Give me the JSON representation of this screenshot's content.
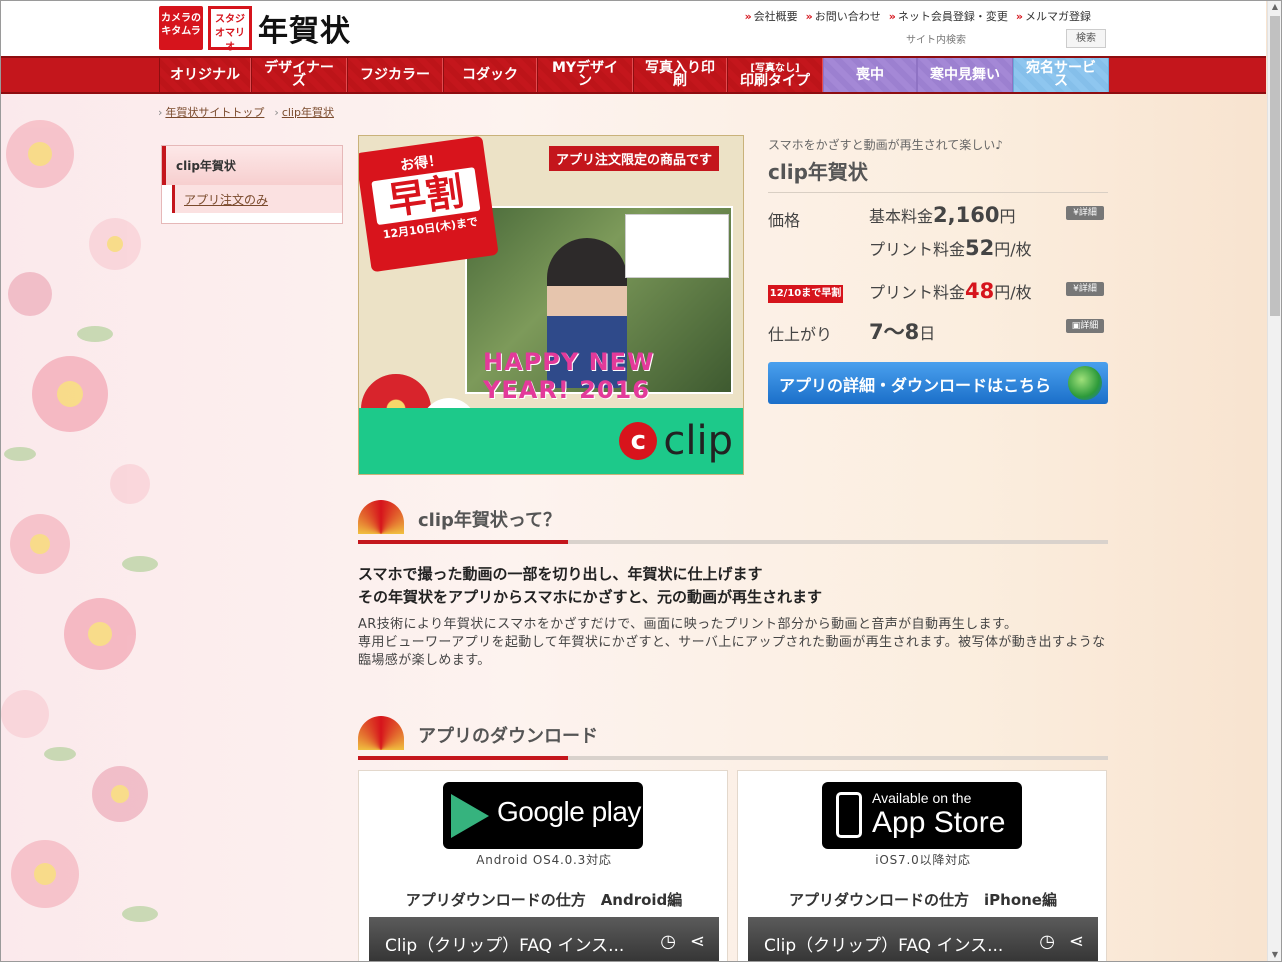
{
  "header": {
    "logo_kitamura": "カメラのキタムラ",
    "logo_mario": "スタジオマリオ",
    "site_title": "年賀状",
    "util_links": [
      "会社概要",
      "お問い合わせ",
      "ネット会員登録・変更",
      "メルマガ登録"
    ],
    "search_label": "サイト内検索",
    "search_button": "検索"
  },
  "nav": {
    "items": [
      {
        "label": "オリジナル",
        "style": "red"
      },
      {
        "label": "デザイナーズ",
        "style": "red"
      },
      {
        "label": "フジカラー",
        "style": "red"
      },
      {
        "label": "コダック",
        "style": "red"
      },
      {
        "label": "MYデザイン",
        "style": "red"
      },
      {
        "label": "写真入り印刷",
        "style": "red"
      },
      {
        "label_small": "[写真なし]",
        "label": "印刷タイプ",
        "style": "red"
      },
      {
        "label": "喪中",
        "style": "purple"
      },
      {
        "label": "寒中見舞い",
        "style": "purple"
      },
      {
        "label": "宛名サービス",
        "style": "lblue"
      }
    ]
  },
  "breadcrumb": [
    "年賀状サイトトップ",
    "clip年賀状"
  ],
  "side_menu": {
    "main": "clip年賀状",
    "sub": "アプリ注文のみ"
  },
  "hero": {
    "ribbon": "アプリ注文限定の商品です",
    "stamp_top": "お得！",
    "stamp_main": "早割",
    "stamp_date": "12月10日(木)まで",
    "greeting": "HAPPY NEW YEAR! 2016",
    "brand": "clip"
  },
  "product": {
    "subtitle": "スマホをかざすと動画が再生されて楽しい♪",
    "title": "clip年賀状",
    "price_label": "価格",
    "base_fee_label": "基本料金",
    "base_fee_value": "2,160",
    "base_fee_unit": "円",
    "print_fee_label": "プリント料金",
    "print_fee_value": "52",
    "print_fee_unit": "円/枚",
    "early_badge": "12/10まで早割",
    "early_fee_label": "プリント料金",
    "early_fee_value": "48",
    "early_fee_unit": "円/枚",
    "finish_label": "仕上がり",
    "finish_value": "7～8",
    "finish_unit": "日",
    "detail_price": "¥詳細",
    "detail_early": "¥詳細",
    "detail_finish": "詳細",
    "download_button": "アプリの詳細・ダウンロードはこちら"
  },
  "section1": {
    "title": "clip年賀状って？",
    "lead_1": "スマホで撮った動画の一部を切り出し、年賀状に仕上げます",
    "lead_2": "その年賀状をアプリからスマホにかざすと、元の動画が再生されます",
    "body_1": "AR技術により年賀状にスマホをかざすだけで、画面に映ったプリント部分から動画と音声が自動再生します。",
    "body_2": "専用ビューワーアプリを起動して年賀状にかざすと、サーバ上にアップされた動画が再生されます。被写体が動き出すような臨場感が楽しめます。"
  },
  "section2": {
    "title": "アプリのダウンロード",
    "android": {
      "badge": "Google play",
      "os_note": "Android OS4.0.3対応",
      "howto": "アプリダウンロードの仕方　Android編",
      "video_title": "Clip（クリップ）FAQ インス..."
    },
    "ios": {
      "badge_small": "Available on the",
      "badge_big": "App Store",
      "os_note": "iOS7.0以降対応",
      "howto": "アプリダウンロードの仕方　iPhone編",
      "video_title": "Clip（クリップ）FAQ インス..."
    }
  },
  "colors": {
    "brand_red": "#c4161c",
    "accent_purple": "#a488d6",
    "accent_lightblue": "#8ec6ef",
    "download_blue": "#1b6fc9"
  }
}
